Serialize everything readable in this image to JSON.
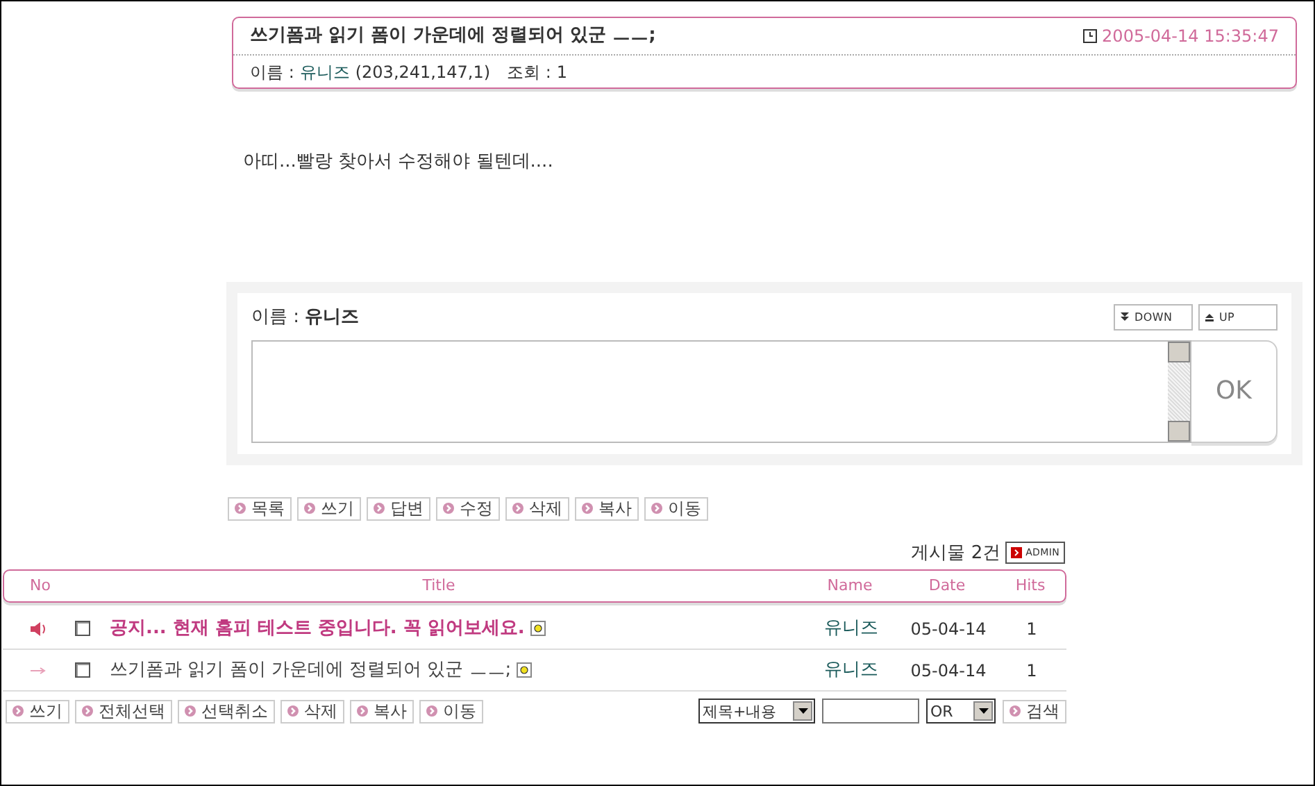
{
  "post": {
    "title": "쓰기폼과 읽기 폼이 가운데에 정렬되어 있군 ㅡㅡ;",
    "datetime": "2005-04-14 15:35:47",
    "name_label": "이름 :",
    "author": "유니즈",
    "ip": "(203,241,147,1)",
    "views_label": "조회 :",
    "views": "1",
    "body": "아띠...빨랑 찾아서 수정해야 될텐데...."
  },
  "comment_form": {
    "name_label": "이름 :",
    "name": "유니즈",
    "down": "DOWN",
    "up": "UP",
    "submit": "OK"
  },
  "post_actions": [
    "목록",
    "쓰기",
    "답변",
    "수정",
    "삭제",
    "복사",
    "이동"
  ],
  "count": "게시물 2건",
  "admin": "ADMIN",
  "table": {
    "columns": [
      "No",
      "Title",
      "Name",
      "Date",
      "Hits"
    ],
    "rows": [
      {
        "kind": "notice",
        "checked": false,
        "title": "공지... 현재 홈피 테스트 중입니다. 꼭 읽어보세요.",
        "name": "유니즈",
        "date": "05-04-14",
        "hits": "1"
      },
      {
        "kind": "current",
        "checked": false,
        "title": "쓰기폼과 읽기 폼이 가운데에 정렬되어 있군 ㅡㅡ;",
        "name": "유니즈",
        "date": "05-04-14",
        "hits": "1"
      }
    ]
  },
  "list_actions": [
    "쓰기",
    "전체선택",
    "선택취소",
    "삭제",
    "복사",
    "이동"
  ],
  "search": {
    "field": "제목+내용",
    "operator": "OR",
    "button": "검색"
  }
}
